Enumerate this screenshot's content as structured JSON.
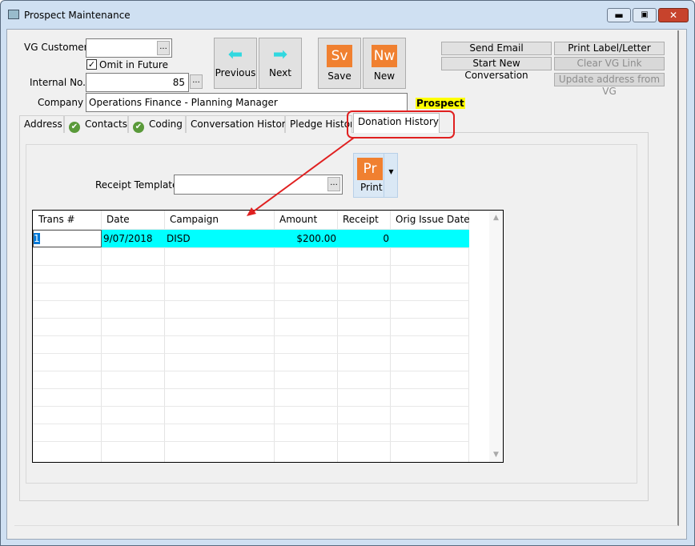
{
  "window": {
    "title": "Prospect Maintenance"
  },
  "form": {
    "vg_customer_label": "VG Customer",
    "vg_customer_value": "",
    "omit_label": "Omit in Future",
    "omit_checked": true,
    "internal_no_label": "Internal No.",
    "internal_no_value": "85",
    "company_label": "Company",
    "company_value": "Operations Finance - Planning Manager",
    "status_badge": "Prospect",
    "ellipsis": "..."
  },
  "toolbar": {
    "previous": "Previous",
    "next": "Next",
    "save": "Save",
    "save_icon": "Sv",
    "new": "New",
    "new_icon": "Nw"
  },
  "actions": {
    "send_email": "Send Email",
    "print_label": "Print Label/Letter",
    "start_conversation": "Start New Conversation",
    "clear_vg": "Clear VG Link",
    "update_address": "Update address from VG"
  },
  "tabs": [
    {
      "label": "Address"
    },
    {
      "label": "Contacts"
    },
    {
      "label": "Coding"
    },
    {
      "label": "Conversation History"
    },
    {
      "label": "Pledge History"
    },
    {
      "label": "Donation History",
      "active": true
    }
  ],
  "donation": {
    "receipt_template_label": "Receipt Template",
    "receipt_template_value": "",
    "print_icon": "Pr",
    "print_label": "Print",
    "columns": [
      "Trans #",
      "Date",
      "Campaign",
      "Amount",
      "Receipt",
      "Orig Issue Date"
    ],
    "rows": [
      {
        "trans": "1",
        "date": "9/07/2018",
        "campaign": "DISD",
        "amount": "$200.00",
        "receipt": "0",
        "orig_issue_date": ""
      }
    ]
  },
  "colors": {
    "selected_row": "#00ffff",
    "badge": "#ffff00",
    "annotation": "#e02020",
    "icon_orange": "#f08030"
  }
}
